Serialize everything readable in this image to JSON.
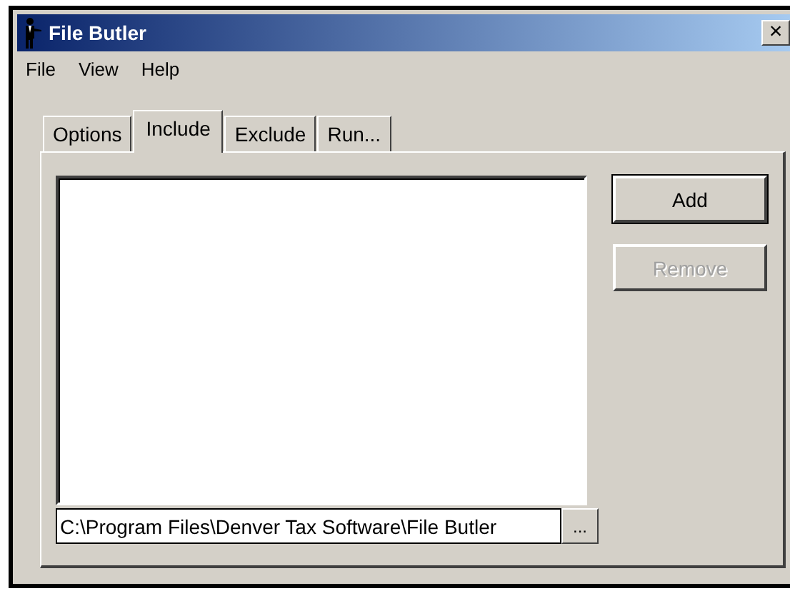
{
  "window": {
    "title": "File Butler",
    "close": "×"
  },
  "menu": [
    "File",
    "View",
    "Help"
  ],
  "tabs": [
    {
      "label": "Options",
      "selected": false
    },
    {
      "label": "Include",
      "selected": true
    },
    {
      "label": "Exclude",
      "selected": false
    },
    {
      "label": "Run...",
      "selected": false
    }
  ],
  "path_field": {
    "value": "C:\\Program Files\\Denver Tax Software\\File Butler"
  },
  "browse_button": "...",
  "buttons": [
    {
      "label": "Add",
      "disabled": false,
      "default": true
    },
    {
      "label": "Remove",
      "disabled": true,
      "default": false
    }
  ]
}
